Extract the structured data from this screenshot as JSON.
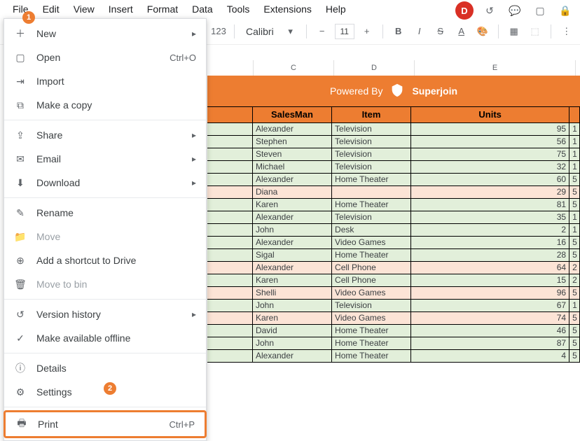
{
  "menubar": [
    "File",
    "Edit",
    "View",
    "Insert",
    "Format",
    "Data",
    "Tools",
    "Extensions",
    "Help"
  ],
  "avatar": "D",
  "toolbar": {
    "zoom": "123",
    "font": "Calibri",
    "fontsize": "11"
  },
  "dropdown": [
    {
      "icon": "plus",
      "label": "New",
      "sub": "▸"
    },
    {
      "icon": "folder",
      "label": "Open",
      "shortcut": "Ctrl+O"
    },
    {
      "icon": "import",
      "label": "Import"
    },
    {
      "icon": "copy",
      "label": "Make a copy"
    },
    {
      "sep": true
    },
    {
      "icon": "share",
      "label": "Share",
      "sub": "▸"
    },
    {
      "icon": "mail",
      "label": "Email",
      "sub": "▸"
    },
    {
      "icon": "download",
      "label": "Download",
      "sub": "▸"
    },
    {
      "sep": true
    },
    {
      "icon": "rename",
      "label": "Rename"
    },
    {
      "icon": "move",
      "label": "Move",
      "disabled": true
    },
    {
      "icon": "drive",
      "label": "Add a shortcut to Drive"
    },
    {
      "icon": "trash",
      "label": "Move to bin",
      "disabled": true
    },
    {
      "sep": true
    },
    {
      "icon": "history",
      "label": "Version history",
      "sub": "▸"
    },
    {
      "icon": "offline",
      "label": "Make available offline"
    },
    {
      "sep": true
    },
    {
      "icon": "info",
      "label": "Details"
    },
    {
      "icon": "gear",
      "label": "Settings"
    },
    {
      "sep": true
    },
    {
      "icon": "print",
      "label": "Print",
      "shortcut": "Ctrl+P",
      "highlight": true
    }
  ],
  "columns": [
    "C",
    "D",
    "E"
  ],
  "banner": {
    "powered": "Powered By",
    "brand": "Superjoin"
  },
  "headers": {
    "c": "SalesMan",
    "d": "Item",
    "e": "Units"
  },
  "rows": [
    {
      "c": "Alexander",
      "d": "Television",
      "e": "95",
      "f": "1",
      "bg": "g"
    },
    {
      "c": "Stephen",
      "d": "Television",
      "e": "56",
      "f": "1",
      "bg": "g"
    },
    {
      "c": "Steven",
      "d": "Television",
      "e": "75",
      "f": "1",
      "bg": "g"
    },
    {
      "c": "Michael",
      "d": "Television",
      "e": "32",
      "f": "1",
      "bg": "g"
    },
    {
      "c": "Alexander",
      "d": "Home Theater",
      "e": "60",
      "f": "5",
      "bg": "g"
    },
    {
      "c": "Diana",
      "d": "",
      "e": "29",
      "f": "5",
      "bg": "o"
    },
    {
      "c": "Karen",
      "d": "Home Theater",
      "e": "81",
      "f": "5",
      "bg": "g"
    },
    {
      "c": "Alexander",
      "d": "Television",
      "e": "35",
      "f": "1",
      "bg": "g"
    },
    {
      "c": "John",
      "d": "Desk",
      "e": "2",
      "f": "1",
      "bg": "g"
    },
    {
      "c": "Alexander",
      "d": "Video Games",
      "e": "16",
      "f": "5",
      "bg": "g"
    },
    {
      "c": "Sigal",
      "d": "Home Theater",
      "e": "28",
      "f": "5",
      "bg": "g"
    },
    {
      "c": "Alexander",
      "d": "Cell Phone",
      "e": "64",
      "f": "2",
      "bg": "o"
    },
    {
      "c": "Karen",
      "d": "Cell Phone",
      "e": "15",
      "f": "2",
      "bg": "g"
    },
    {
      "c": "Shelli",
      "d": "Video Games",
      "e": "96",
      "f": "5",
      "bg": "o"
    },
    {
      "c": "John",
      "d": "Television",
      "e": "67",
      "f": "1",
      "bg": "g"
    },
    {
      "c": "Karen",
      "d": "Video Games",
      "e": "74",
      "f": "5",
      "bg": "o"
    },
    {
      "c": "David",
      "d": "Home Theater",
      "e": "46",
      "f": "5",
      "bg": "g"
    },
    {
      "c": "John",
      "d": "Home Theater",
      "e": "87",
      "f": "5",
      "bg": "g"
    },
    {
      "c": "Alexander",
      "d": "Home Theater",
      "e": "4",
      "f": "5",
      "bg": "g"
    }
  ],
  "annot": {
    "one": "1",
    "two": "2"
  }
}
